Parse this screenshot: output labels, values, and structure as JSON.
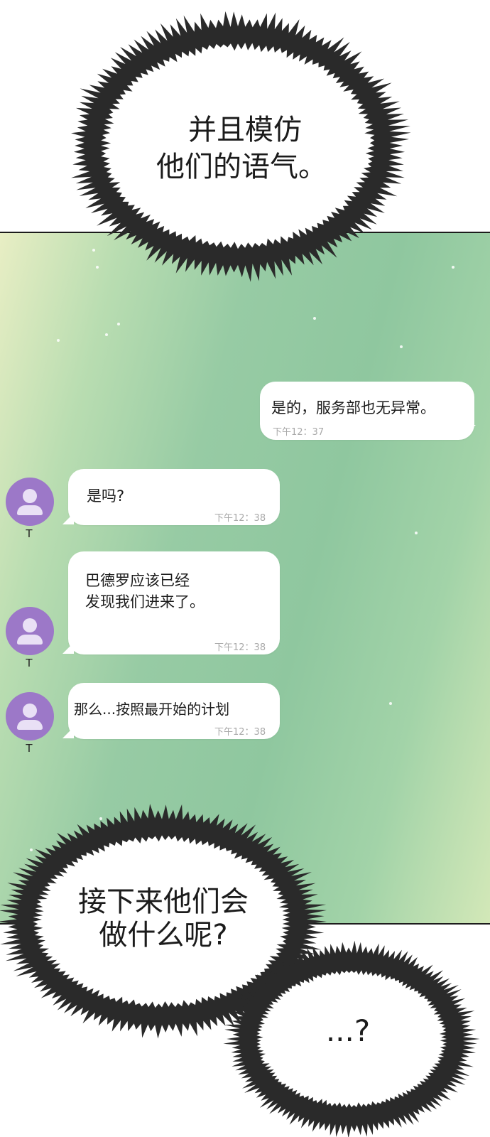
{
  "captions": {
    "top_line1": "并且模仿",
    "top_line2": "他们的语气。",
    "bottom_left": "接下来他们会\n做什么呢?",
    "bottom_right": "...?"
  },
  "chat": {
    "sent": {
      "text": "是的，服务部也无异常。",
      "time": "下午12：37"
    },
    "received": [
      {
        "sender": "T",
        "avatar_icon": "person-icon",
        "text": "是吗?",
        "time": "下午12：38"
      },
      {
        "sender": "T",
        "avatar_icon": "person-icon",
        "text": "巴德罗应该已经\n发现我们进来了。",
        "time": "下午12：38"
      },
      {
        "sender": "T",
        "avatar_icon": "person-icon",
        "text": "那么...按照最开始的计划",
        "time": "下午12：38"
      }
    ]
  },
  "colors": {
    "panel_gradient": [
      "#e8eec4",
      "#8fc79f",
      "#d3e8b8"
    ],
    "avatar": "#9c78c8",
    "bubble": "#ffffff",
    "burst_ink": "#2a2a2a"
  }
}
